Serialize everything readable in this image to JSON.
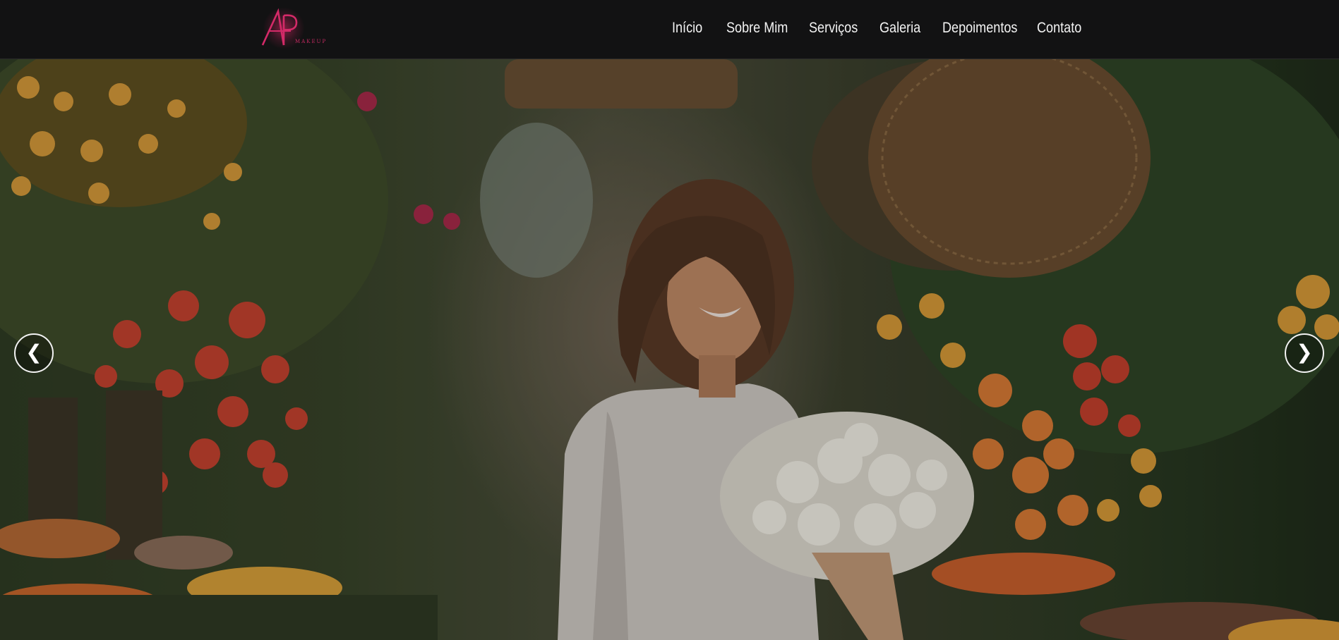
{
  "brand": {
    "logo_letters": "AP",
    "logo_subtext": "MAKEUP",
    "accent_color": "#d42a68"
  },
  "nav": {
    "items": [
      {
        "label": "Início"
      },
      {
        "label": "Sobre Mim"
      },
      {
        "label": "Serviços"
      },
      {
        "label": "Galeria"
      },
      {
        "label": "Depoimentos"
      },
      {
        "label": "Contato"
      }
    ]
  },
  "carousel": {
    "prev_label": "❮",
    "next_label": "❯",
    "slide_image": "bride-with-white-bouquet-photo"
  }
}
